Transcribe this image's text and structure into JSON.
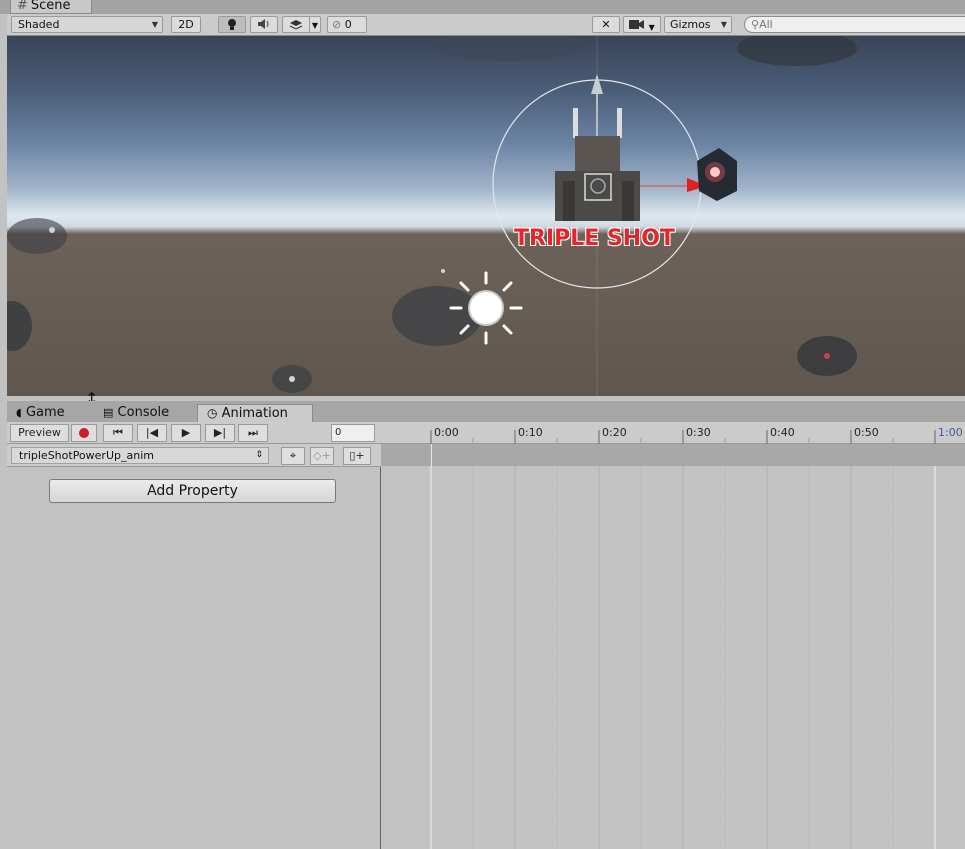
{
  "scene_tab": {
    "label": "Scene"
  },
  "scene_toolbar": {
    "shading_mode": "Shaded",
    "mode_2d": "2D",
    "hidden_count": "0",
    "gizmos": "Gizmos",
    "search_placeholder": "All"
  },
  "scene": {
    "powerup_label": "TRIPLE SHOT"
  },
  "bottom_tabs": {
    "game": "Game",
    "console": "Console",
    "animation": "Animation"
  },
  "animation": {
    "preview": "Preview",
    "frame": "0",
    "clip_name": "tripleShotPowerUp_anim",
    "add_property": "Add Property",
    "timeline_ticks": [
      "0:00",
      "0:10",
      "0:20",
      "0:30",
      "0:40",
      "0:50",
      "1:00"
    ]
  },
  "colors": {
    "record_red": "#c8202a",
    "label_red": "#e3262c",
    "accent_blue": "#3a5c9c"
  }
}
